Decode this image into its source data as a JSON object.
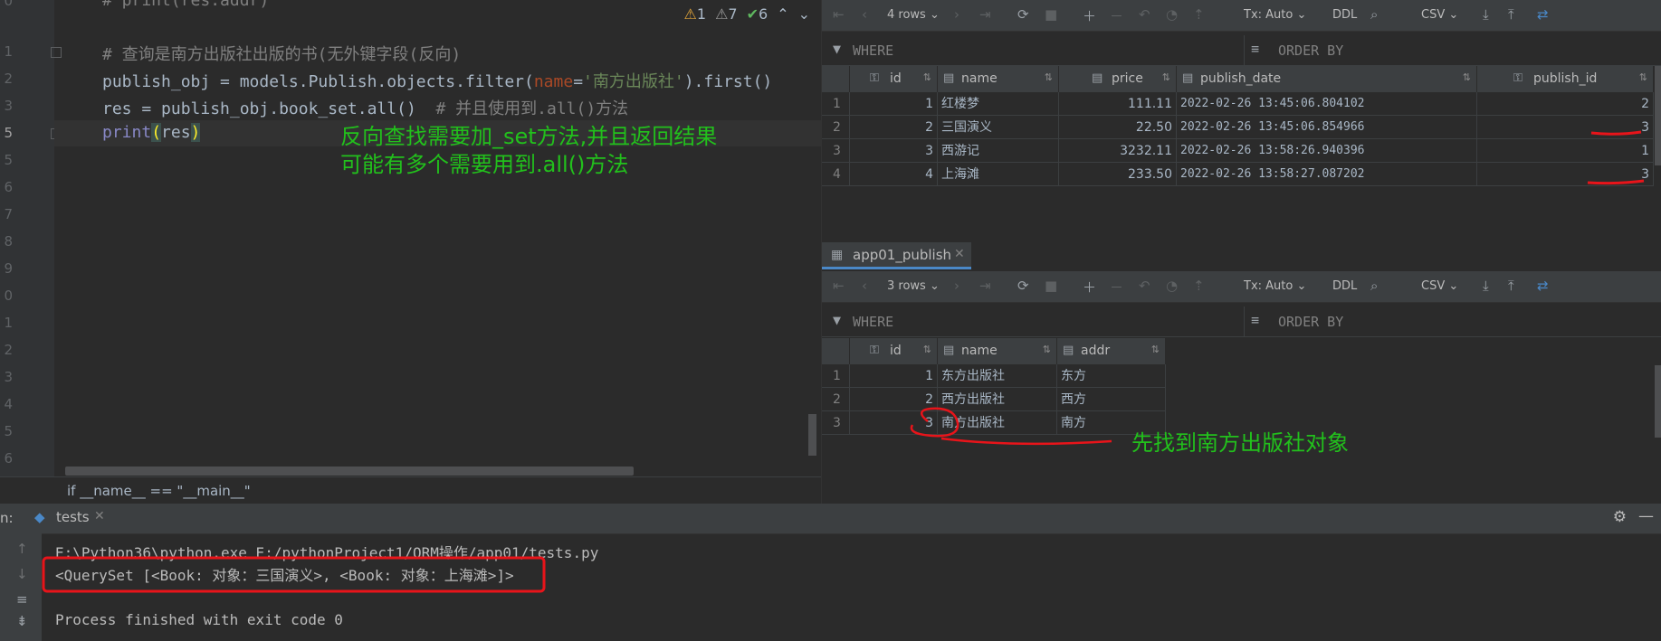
{
  "editor": {
    "line_numbers": [
      "0",
      "1",
      "2",
      "3",
      "4",
      "5",
      "6",
      "7",
      "8",
      "9",
      "0",
      "1",
      "2",
      "3",
      "4",
      "5",
      "6",
      "7"
    ],
    "current_line_number": "5",
    "lines": {
      "l0": "# print(res.addr)",
      "l2": "# 查询是南方出版社出版的书(无外键字段(反向)",
      "l3a": "publish_obj = models.Publish.objects.filter(",
      "l3b": "name",
      "l3c": "=",
      "l3d": "'南方出版社'",
      "l3e": ").first()",
      "l4a": "res = publish_obj.book_set.all()  ",
      "l4b": "# 并且使用到.all()方法",
      "l5a": "print",
      "l5b": "(",
      "l5c": "res",
      "l5d": ")"
    },
    "inspections": {
      "warnings": "1",
      "weak_warnings": "7",
      "typos": "6"
    },
    "annotation": "反向查找需要加_set方法,并且返回结果\n可能有多个需要用到.all()方法",
    "breadcrumb": "if __name__ == \"__main__\""
  },
  "db": {
    "toolbar1": {
      "rows": "4 rows",
      "tx": "Tx: Auto",
      "ddl": "DDL",
      "export": "CSV"
    },
    "filter1": {
      "where": "WHERE",
      "order_by": "ORDER BY"
    },
    "book_table": {
      "columns": [
        "id",
        "name",
        "price",
        "publish_date",
        "publish_id"
      ],
      "rows": [
        {
          "n": "1",
          "id": "1",
          "name": "红楼梦",
          "price": "111.11",
          "date": "2022-02-26 13:45:06.804102",
          "pid": "2"
        },
        {
          "n": "2",
          "id": "2",
          "name": "三国演义",
          "price": "22.50",
          "date": "2022-02-26 13:45:06.854966",
          "pid": "3"
        },
        {
          "n": "3",
          "id": "3",
          "name": "西游记",
          "price": "3232.11",
          "date": "2022-02-26 13:58:26.940396",
          "pid": "1"
        },
        {
          "n": "4",
          "id": "4",
          "name": "上海滩",
          "price": "233.50",
          "date": "2022-02-26 13:58:27.087202",
          "pid": "3"
        }
      ]
    },
    "tab2_label": "app01_publish",
    "toolbar2": {
      "rows": "3 rows",
      "tx": "Tx: Auto",
      "ddl": "DDL",
      "export": "CSV"
    },
    "filter2": {
      "where": "WHERE",
      "order_by": "ORDER BY"
    },
    "publish_table": {
      "columns": [
        "id",
        "name",
        "addr"
      ],
      "rows": [
        {
          "n": "1",
          "id": "1",
          "name": "东方出版社",
          "addr": "东方"
        },
        {
          "n": "2",
          "id": "2",
          "name": "西方出版社",
          "addr": "西方"
        },
        {
          "n": "3",
          "id": "3",
          "name": "南方出版社",
          "addr": "南方"
        }
      ]
    },
    "annotation": "先找到南方出版社对象"
  },
  "run": {
    "label": "n:",
    "tab": "tests",
    "output": [
      "E:\\Python36\\python.exe E:/pythonProject1/ORM操作/app01/tests.py",
      "<QuerySet [<Book: 对象：三国演义>, <Book: 对象：上海滩>]>",
      "",
      "Process finished with exit code 0"
    ]
  },
  "colors": {
    "annotation_green": "#22c01c",
    "markup_red": "#e8141a",
    "accent_blue": "#4a88c7"
  }
}
